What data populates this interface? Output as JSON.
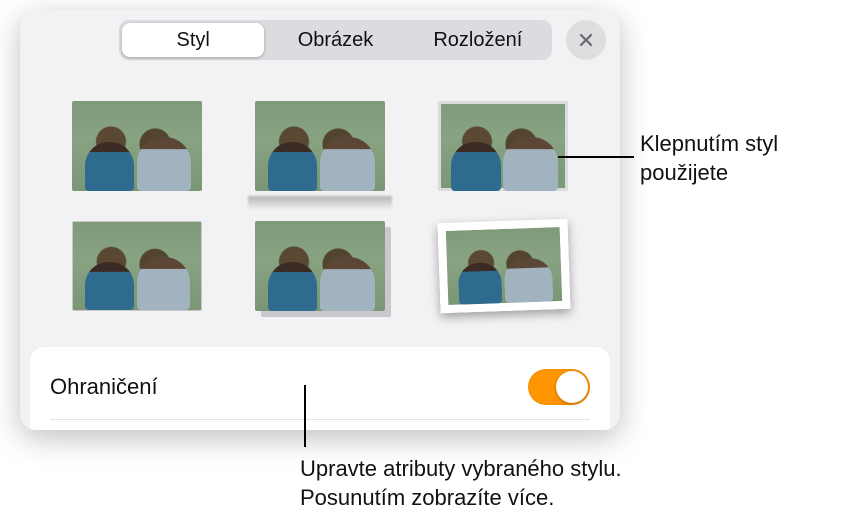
{
  "tabs": {
    "style": "Styl",
    "image": "Obrázek",
    "layout": "Rozložení"
  },
  "styles": [
    {
      "id": "plain",
      "name": "style-plain"
    },
    {
      "id": "reflect",
      "name": "style-reflection"
    },
    {
      "id": "border",
      "name": "style-thin-border"
    },
    {
      "id": "borderthick",
      "name": "style-gray-border"
    },
    {
      "id": "drop",
      "name": "style-drop-shadow"
    },
    {
      "id": "paper",
      "name": "style-polaroid"
    }
  ],
  "controls": {
    "border_label": "Ohraničení",
    "border_on": true
  },
  "callouts": {
    "apply": "Klepnutím styl použijete",
    "edit": "Upravte atributy vybraného stylu. Posunutím zobrazíte více."
  },
  "colors": {
    "accent": "#ff9500"
  }
}
